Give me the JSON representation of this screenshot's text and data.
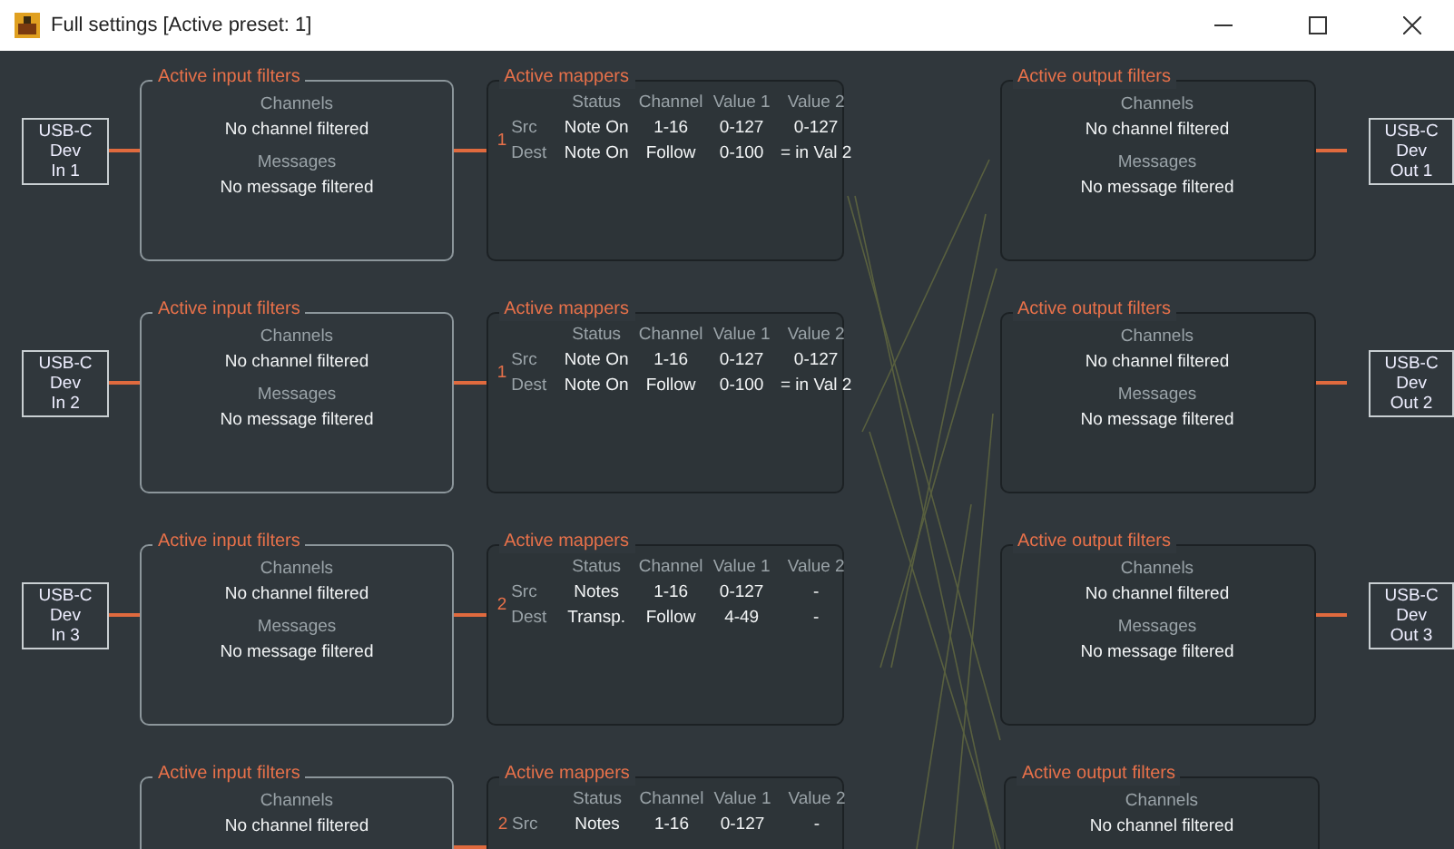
{
  "window": {
    "title": "Full settings [Active preset: 1]"
  },
  "rows": [
    {
      "input_device": [
        "USB-C",
        "Dev",
        "In 1"
      ],
      "input_filters": {
        "title": "Active input filters",
        "channels_label": "Channels",
        "channels_value": "No channel filtered",
        "messages_label": "Messages",
        "messages_value": "No message filtered"
      },
      "mappers": {
        "title": "Active mappers",
        "index": "1",
        "columns": [
          "Status",
          "Channel",
          "Value 1",
          "Value 2"
        ],
        "rows": [
          {
            "label": "Src",
            "cells": [
              "Note On",
              "1-16",
              "0-127",
              "0-127"
            ]
          },
          {
            "label": "Dest",
            "cells": [
              "Note On",
              "Follow",
              "0-100",
              "= in Val 2"
            ]
          }
        ]
      },
      "output_filters": {
        "title": "Active output filters",
        "channels_label": "Channels",
        "channels_value": "No channel filtered",
        "messages_label": "Messages",
        "messages_value": "No message filtered"
      },
      "output_device": [
        "USB-C",
        "Dev",
        "Out 1"
      ]
    },
    {
      "input_device": [
        "USB-C",
        "Dev",
        "In 2"
      ],
      "input_filters": {
        "title": "Active input filters",
        "channels_label": "Channels",
        "channels_value": "No channel filtered",
        "messages_label": "Messages",
        "messages_value": "No message filtered"
      },
      "mappers": {
        "title": "Active mappers",
        "index": "1",
        "columns": [
          "Status",
          "Channel",
          "Value 1",
          "Value 2"
        ],
        "rows": [
          {
            "label": "Src",
            "cells": [
              "Note On",
              "1-16",
              "0-127",
              "0-127"
            ]
          },
          {
            "label": "Dest",
            "cells": [
              "Note On",
              "Follow",
              "0-100",
              "= in Val 2"
            ]
          }
        ]
      },
      "output_filters": {
        "title": "Active output filters",
        "channels_label": "Channels",
        "channels_value": "No channel filtered",
        "messages_label": "Messages",
        "messages_value": "No message filtered"
      },
      "output_device": [
        "USB-C",
        "Dev",
        "Out 2"
      ]
    },
    {
      "input_device": [
        "USB-C",
        "Dev",
        "In 3"
      ],
      "input_filters": {
        "title": "Active input filters",
        "channels_label": "Channels",
        "channels_value": "No channel filtered",
        "messages_label": "Messages",
        "messages_value": "No message filtered"
      },
      "mappers": {
        "title": "Active mappers",
        "index": "2",
        "columns": [
          "Status",
          "Channel",
          "Value 1",
          "Value 2"
        ],
        "rows": [
          {
            "label": "Src",
            "cells": [
              "Notes",
              "1-16",
              "0-127",
              "-"
            ]
          },
          {
            "label": "Dest",
            "cells": [
              "Transp.",
              "Follow",
              "4-49",
              "-"
            ]
          }
        ]
      },
      "output_filters": {
        "title": "Active output filters",
        "channels_label": "Channels",
        "channels_value": "No channel filtered",
        "messages_label": "Messages",
        "messages_value": "No message filtered"
      },
      "output_device": [
        "USB-C",
        "Dev",
        "Out 3"
      ]
    },
    {
      "input_filters": {
        "title": "Active input filters",
        "channels_label": "Channels",
        "channels_value": "No channel filtered"
      },
      "mappers": {
        "title": "Active mappers",
        "index": "2",
        "columns": [
          "Status",
          "Channel",
          "Value 1",
          "Value 2"
        ],
        "rows": [
          {
            "label": "Src",
            "cells": [
              "Notes",
              "1-16",
              "0-127",
              "-"
            ]
          }
        ]
      },
      "output_filters": {
        "title": "Active output filters",
        "channels_label": "Channels",
        "channels_value": "No channel filtered"
      }
    }
  ]
}
